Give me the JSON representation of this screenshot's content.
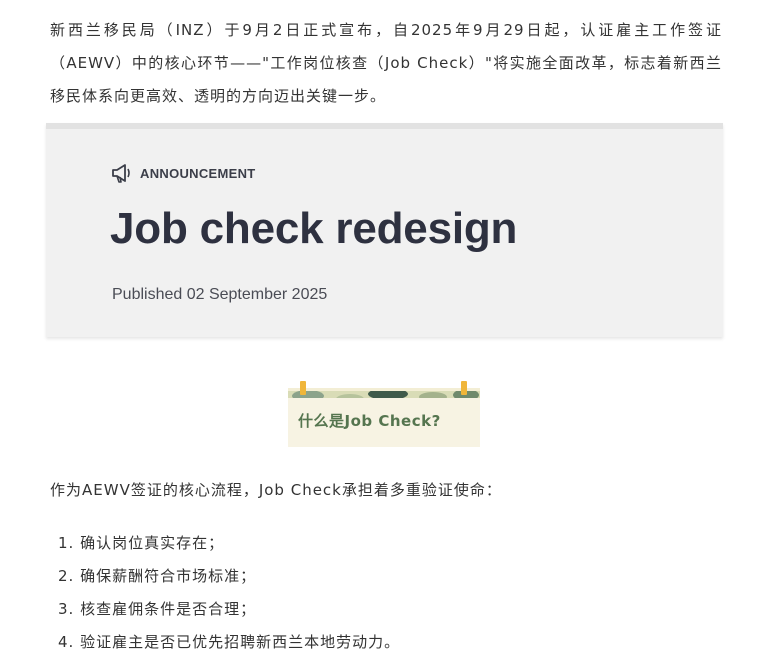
{
  "article": {
    "intro": "新西兰移民局（INZ）于9月2日正式宣布，自2025年9月29日起，认证雇主工作签证（AEWV）中的核心环节——\"工作岗位核查（Job Check）\"将实施全面改革，标志着新西兰移民体系向更高效、透明的方向迈出关键一步。",
    "banner": {
      "icon": "megaphone-icon",
      "label": "ANNOUNCEMENT",
      "title": "Job check redesign",
      "published": "Published 02 September 2025",
      "background": "#f1f1f1"
    },
    "section_heading": {
      "text": "什么是Job Check?",
      "color": "#55754f"
    },
    "paragraph": "作为AEWV签证的核心流程，Job Check承担着多重验证使命：",
    "list": [
      "1. 确认岗位真实存在；",
      "2. 确保薪酬符合市场标准；",
      "3. 核查雇佣条件是否合理；",
      "4. 验证雇主是否已优先招聘新西兰本地劳动力。"
    ]
  }
}
